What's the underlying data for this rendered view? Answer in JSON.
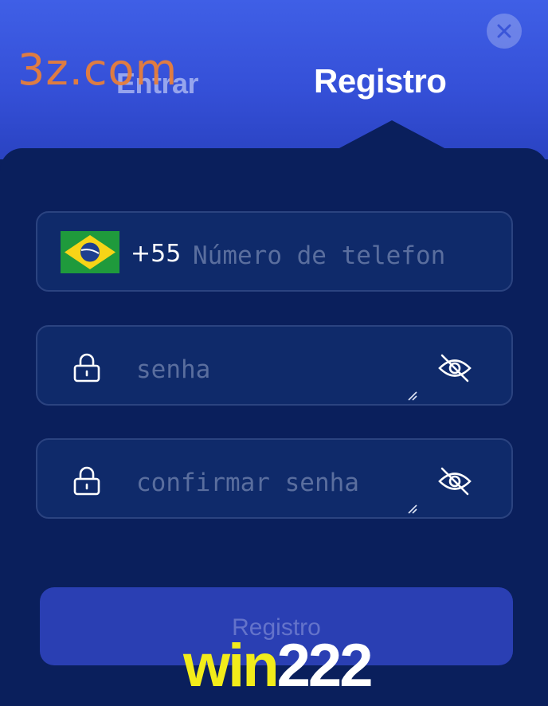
{
  "tabs": {
    "login": "Entrar",
    "register": "Registro"
  },
  "watermarks": {
    "top": "3z.com",
    "bottom_a": "win",
    "bottom_b": "222"
  },
  "icons": {
    "close": "close-icon",
    "flag": "brazil-flag-icon",
    "lock": "lock-icon",
    "eye_off": "eye-off-icon",
    "resize": "resize-handle-icon"
  },
  "form": {
    "country_code": "+55",
    "phone_placeholder": "Número de telefon",
    "password_placeholder": "senha",
    "confirm_placeholder": "confirmar senha",
    "submit_label": "Registro"
  },
  "colors": {
    "header": "#3f5fe6",
    "panel": "#0a1f5c",
    "field_border": "#2b4380",
    "button": "#2a3fb3",
    "watermark_orange": "#e87f3a",
    "watermark_yellow": "#f2ec1a"
  }
}
